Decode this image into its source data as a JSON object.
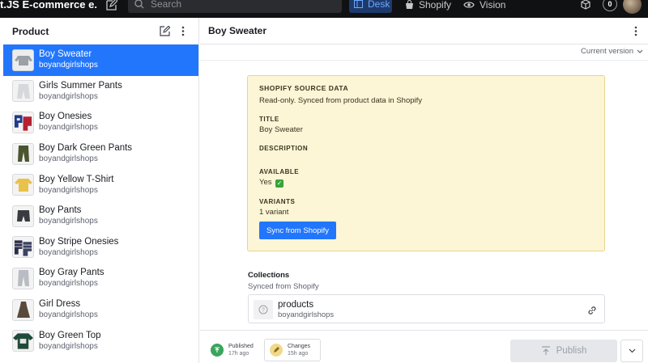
{
  "topbar": {
    "app_title": "t.JS E-commerce e...",
    "search_placeholder": "Search",
    "tools": [
      {
        "label": "Desk",
        "icon": "desk-icon"
      },
      {
        "label": "Shopify",
        "icon": "shopify-bag-icon"
      },
      {
        "label": "Vision",
        "icon": "eye-icon"
      }
    ],
    "notification_count": "0"
  },
  "sidebar": {
    "title": "Product",
    "items": [
      {
        "title": "Boy Sweater",
        "subtitle": "boyandgirlshops",
        "selected": true
      },
      {
        "title": "Girls Summer Pants",
        "subtitle": "boyandgirlshops"
      },
      {
        "title": "Boy Onesies",
        "subtitle": "boyandgirlshops"
      },
      {
        "title": "Boy Dark Green Pants",
        "subtitle": "boyandgirlshops"
      },
      {
        "title": "Boy Yellow T-Shirt",
        "subtitle": "boyandgirlshops"
      },
      {
        "title": "Boy Pants",
        "subtitle": "boyandgirlshops"
      },
      {
        "title": "Boy Stripe Onesies",
        "subtitle": "boyandgirlshops"
      },
      {
        "title": "Boy Gray Pants",
        "subtitle": "boyandgirlshops"
      },
      {
        "title": "Girl Dress",
        "subtitle": "boyandgirlshops"
      },
      {
        "title": "Boy Green Top",
        "subtitle": "boyandgirlshops"
      }
    ]
  },
  "main": {
    "title": "Boy Sweater",
    "version": "Current version",
    "source": {
      "heading": "SHOPIFY SOURCE DATA",
      "note": "Read-only. Synced from product data in Shopify",
      "title_label": "TITLE",
      "title_value": "Boy Sweater",
      "description_label": "DESCRIPTION",
      "available_label": "AVAILABLE",
      "available_value": "Yes",
      "variants_label": "VARIANTS",
      "variants_value": "1 variant",
      "sync_button": "Sync from Shopify"
    },
    "collections": {
      "title": "Collections",
      "subtitle": "Synced from Shopify",
      "ref_title": "products",
      "ref_subtitle": "boyandgirlshops"
    }
  },
  "footer": {
    "published_label": "Published",
    "published_time": "17h ago",
    "changes_label": "Changes",
    "changes_time": "15h ago",
    "publish_button": "Publish"
  },
  "colors": {
    "accent": "#2276fc",
    "topbar": "#101112",
    "source_card_bg": "#fcf5d6",
    "source_card_border": "#ead48a",
    "published_green": "#3aa55c"
  }
}
